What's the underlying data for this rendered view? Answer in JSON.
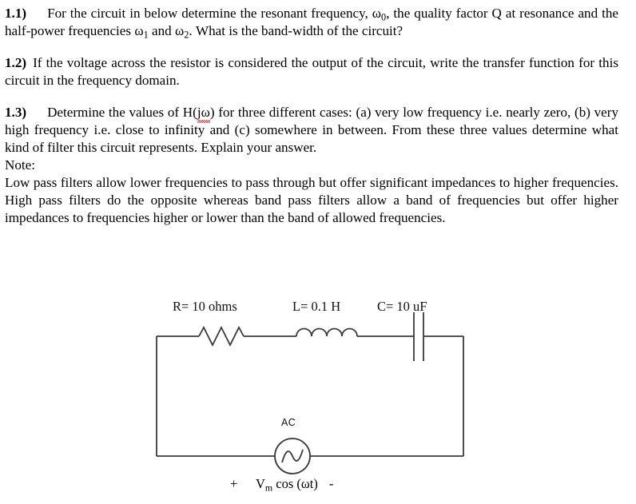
{
  "document": {
    "questions": [
      {
        "number": "1.1)",
        "text_before_w0": "For the circuit in below determine the resonant frequency, ",
        "omega": "ω",
        "sub_0": "0",
        "text_mid": ", the quality factor Q at resonance and the half-power frequencies ",
        "sub_1": "1",
        "text_and": " and ",
        "sub_2": "2",
        "text_end": ".  What is the band-width of the circuit?"
      },
      {
        "number": "1.2)",
        "text": "If the voltage across the resistor is considered the output of the circuit, write the transfer function for this circuit in the frequency domain."
      },
      {
        "number": "1.3)",
        "text_before": "Determine the values of H(",
        "misspelled": "jω",
        "text_after": ") for three different cases: (a) very low frequency i.e. nearly zero, (b) very high frequency i.e. close to infinity and (c) somewhere in between. From these three values determine what kind of filter this circuit represents.  Explain your answer."
      }
    ],
    "note_heading": "Note:",
    "note_body": "Low pass filters allow lower frequencies to pass through but offer significant impedances to higher frequencies. High pass filters do the opposite whereas band pass filters allow a band of frequencies but offer higher impedances to frequencies higher or lower than the band of allowed frequencies.",
    "spellcheck_color": "#d61f1f"
  },
  "circuit": {
    "labels": {
      "resistor": "R= 10 ohms",
      "inductor": "L= 0.1 H",
      "capacitor": "C= 10 uF",
      "source": "AC"
    },
    "source_expression": {
      "plus": "+",
      "v": "V",
      "v_sub": "m",
      "cos": " cos (",
      "omega_t": "ωt",
      "close": ")",
      "minus": "-"
    },
    "values": {
      "resistance_ohms": 10,
      "inductance_henries": 0.1,
      "capacitance_microfarads": 10
    },
    "wire_color": "#3a3a3a",
    "components": [
      "resistor",
      "inductor",
      "capacitor",
      "ac-source"
    ],
    "topology": "series RLC loop driven by AC voltage source"
  }
}
